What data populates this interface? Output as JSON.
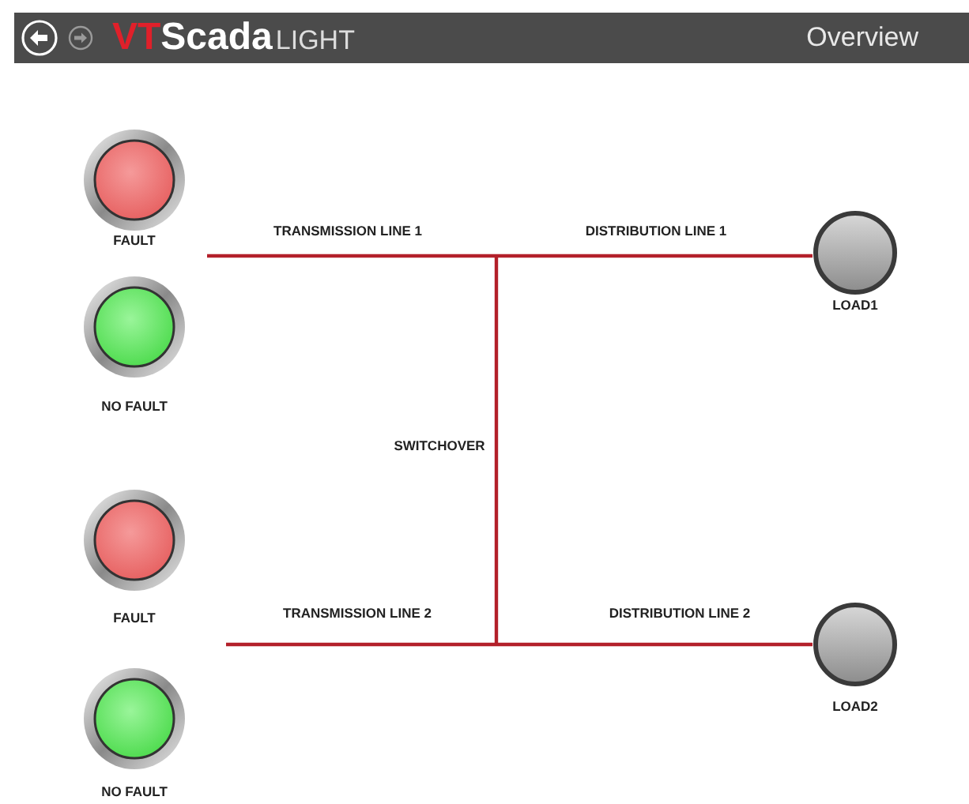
{
  "header": {
    "logo": {
      "mark": "VT",
      "name": "Scada",
      "edition": "LIGHT"
    },
    "title": "Overview"
  },
  "indicators": [
    {
      "label": "FAULT",
      "fault": true
    },
    {
      "label": "NO FAULT",
      "fault": false
    },
    {
      "label": "FAULT",
      "fault": true
    },
    {
      "label": "NO FAULT",
      "fault": false
    }
  ],
  "transmission_lines": [
    {
      "label": "TRANSMISSION LINE 1"
    },
    {
      "label": "TRANSMISSION LINE 2"
    }
  ],
  "distribution_lines": [
    {
      "label": "DISTRIBUTION LINE 1"
    },
    {
      "label": "DISTRIBUTION LINE 2"
    }
  ],
  "switchover": {
    "label": "SWITCHOVER"
  },
  "loads": [
    {
      "label": "LOAD1"
    },
    {
      "label": "LOAD2"
    }
  ]
}
